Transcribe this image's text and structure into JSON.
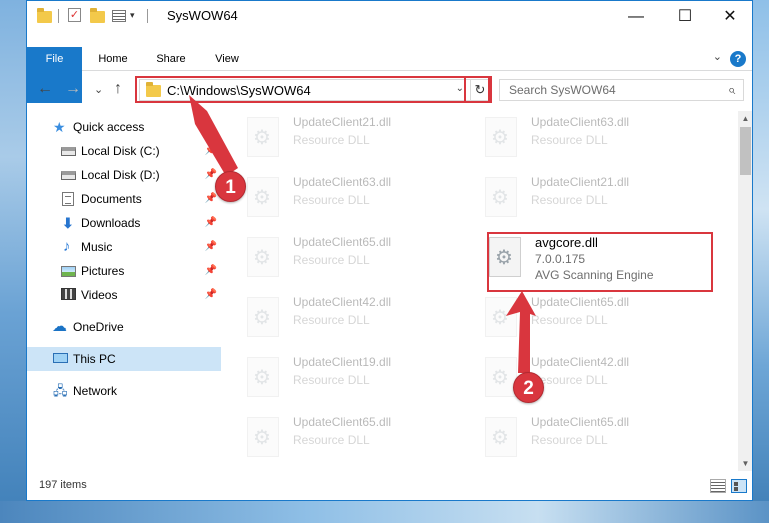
{
  "window": {
    "title": "SysWOW64",
    "controls": {
      "minimize": "—",
      "maximize": "☐",
      "close": "✕"
    }
  },
  "ribbon": {
    "tabs": [
      "File",
      "Home",
      "Share",
      "View"
    ],
    "expand": "⌄",
    "help": "?"
  },
  "toolbar": {
    "back": "←",
    "forward": "→",
    "recent": "⌄",
    "up": "↑",
    "address": "C:\\Windows\\SysWOW64",
    "address_dropdown": "⌄",
    "refresh": "↻",
    "search_placeholder": "Search SysWOW64",
    "search_icon": "⌕"
  },
  "sidebar": {
    "items": [
      {
        "label": "Quick access",
        "icon": "star-icon"
      },
      {
        "label": "Local Disk (C:)",
        "icon": "drive-icon",
        "pinned": true
      },
      {
        "label": "Local Disk (D:)",
        "icon": "drive-icon",
        "pinned": true
      },
      {
        "label": "Documents",
        "icon": "documents-icon",
        "pinned": true
      },
      {
        "label": "Downloads",
        "icon": "download-icon",
        "pinned": true
      },
      {
        "label": "Music",
        "icon": "music-icon",
        "pinned": true
      },
      {
        "label": "Pictures",
        "icon": "pictures-icon",
        "pinned": true
      },
      {
        "label": "Videos",
        "icon": "videos-icon",
        "pinned": true
      },
      {
        "label": "OneDrive",
        "icon": "cloud-icon"
      },
      {
        "label": "This PC",
        "icon": "computer-icon",
        "selected": true
      },
      {
        "label": "Network",
        "icon": "network-icon"
      }
    ],
    "pin_glyph": "📌"
  },
  "files": [
    {
      "name": "UpdateClient21.dll",
      "desc": "Resource DLL",
      "faded": true
    },
    {
      "name": "UpdateClient63.dll",
      "desc": "Resource DLL",
      "faded": true
    },
    {
      "name": "UpdateClient63.dll",
      "desc": "Resource DLL",
      "faded": true
    },
    {
      "name": "UpdateClient21.dll",
      "desc": "Resource DLL",
      "faded": true
    },
    {
      "name": "UpdateClient65.dll",
      "desc": "Resource DLL",
      "faded": true
    },
    {
      "name": "avgcore.dll",
      "desc": "7.0.0.175",
      "desc2": "AVG Scanning Engine",
      "faded": false
    },
    {
      "name": "UpdateClient42.dll",
      "desc": "Resource DLL",
      "faded": true
    },
    {
      "name": "UpdateClient65.dll",
      "desc": "Resource DLL",
      "faded": true
    },
    {
      "name": "UpdateClient19.dll",
      "desc": "Resource DLL",
      "faded": true
    },
    {
      "name": "UpdateClient42.dll",
      "desc": "Resource DLL",
      "faded": true
    },
    {
      "name": "UpdateClient65.dll",
      "desc": "Resource DLL",
      "faded": true
    },
    {
      "name": "UpdateClient65.dll",
      "desc": "Resource DLL",
      "faded": true
    }
  ],
  "status": {
    "count": "197 items"
  },
  "annotations": {
    "callout_1": "1",
    "callout_2": "2",
    "color": "#d9363e"
  },
  "colors": {
    "accent": "#1979ca",
    "highlight": "#d9363e",
    "selected": "#cce4f7"
  }
}
